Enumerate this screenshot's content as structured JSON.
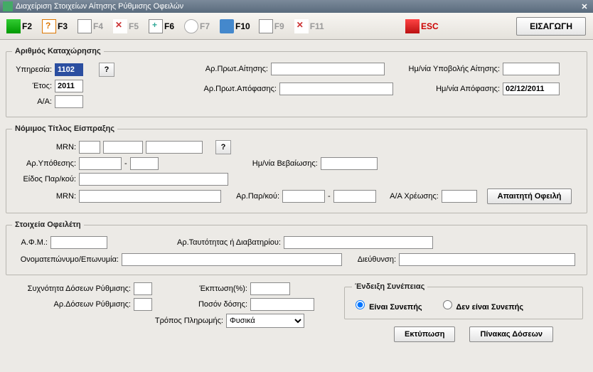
{
  "window": {
    "title": "Διαχείριση Στοιχείων Αίτησης Ρύθμισης Οφειλών"
  },
  "toolbar": {
    "f2": "F2",
    "f3": "F3",
    "f4": "F4",
    "f5": "F5",
    "f6": "F6",
    "f7": "F7",
    "f10": "F10",
    "f9": "F9",
    "f11": "F11",
    "esc": "ESC",
    "insert": "ΕΙΣΑΓΩΓΗ"
  },
  "reg": {
    "legend": "Αριθμός Καταχώρησης",
    "ypiresia_label": "Υπηρεσία:",
    "ypiresia": "1102",
    "etos_label": "Έτος:",
    "etos": "2011",
    "aa_label": "Α/Α:",
    "aa": "",
    "q": "?",
    "arprot_aitisis_label": "Αρ.Πρωτ.Αίτησης:",
    "arprot_aitisis": "",
    "hm_ypovolis_label": "Ημ/νία Υποβολής Αίτησης:",
    "hm_ypovolis": "",
    "arprot_apof_label": "Αρ.Πρωτ.Απόφασης:",
    "arprot_apof": "",
    "hm_apof_label": "Ημ/νία Απόφασης:",
    "hm_apof": "02/12/2011"
  },
  "title": {
    "legend": "Νόμιμος Τίτλος Είσπραξης",
    "mrn_label": "MRN:",
    "mrn1": "",
    "mrn2": "",
    "mrn3": "",
    "q": "?",
    "ar_ypoth_label": "Αρ.Υπόθεσης:",
    "ar_ypoth1": "",
    "ar_ypoth2": "",
    "hm_vev_label": "Ημ/νία Βεβαίωσης:",
    "hm_vev": "",
    "eidos_label": "Είδος Παρ/κού:",
    "eidos": "",
    "mrn2_label": "MRN:",
    "mrn2v": "",
    "arpar_label": "Αρ.Παρ/κού:",
    "arpar1": "",
    "arpar2": "",
    "aaxr_label": "Α/Α Χρέωσης:",
    "aaxr": "",
    "apaititi_btn": "Απαιτητή Οφειλή"
  },
  "debtor": {
    "legend": "Στοιχεία Οφειλέτη",
    "afm_label": "Α.Φ.Μ.:",
    "afm": "",
    "taut_label": "Αρ.Ταυτότητας ή Διαβατηρίου:",
    "taut": "",
    "onoma_label": "Ονοματεπώνυμο/Επωνυμία:",
    "onoma": "",
    "addr_label": "Διεύθυνση:",
    "addr": ""
  },
  "inst": {
    "syxn_label": "Συχνότητα Δόσεων Ρύθμισης:",
    "syxn": "",
    "ardos_label": "Αρ.Δόσεων Ρύθμισης:",
    "ardos": "",
    "ekpt_label": "Έκπτωση(%):",
    "ekpt": "",
    "poson_label": "Ποσόν δόσης:",
    "poson": "",
    "tropos_label": "Τρόπος Πληρωμής:",
    "tropos_selected": "Φυσικά"
  },
  "consist": {
    "legend": "Ένδειξη Συνέπειας",
    "yes": "Είναι Συνεπής",
    "no": "Δεν είναι Συνεπής"
  },
  "buttons": {
    "print": "Εκτύπωση",
    "pinakas": "Πίνακας Δόσεων"
  }
}
